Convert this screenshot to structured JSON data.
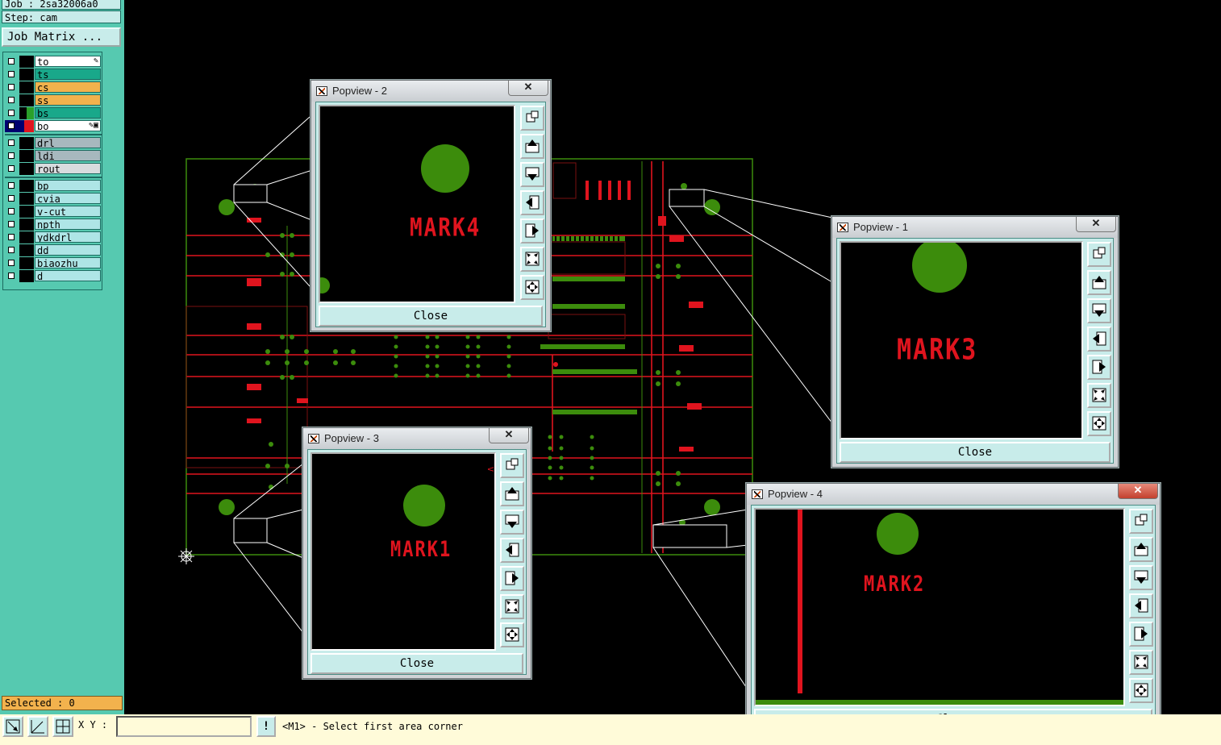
{
  "header": {
    "job": "Job : 2sa32006a0",
    "step": "Step: cam",
    "job_matrix": "Job Matrix ..."
  },
  "layers": {
    "board": [
      {
        "name": "to",
        "color": "#ffffff"
      },
      {
        "name": "ts",
        "color": "#19a88a"
      },
      {
        "name": "cs",
        "color": "#f2b24d"
      },
      {
        "name": "ss",
        "color": "#f2b24d"
      },
      {
        "name": "bs",
        "color": "#19a88a"
      },
      {
        "name": "bo",
        "color": "#ffffff"
      }
    ],
    "drill": [
      {
        "name": "drl",
        "color": "#a7b8be"
      },
      {
        "name": "ldi",
        "color": "#a7b8be"
      },
      {
        "name": "rout",
        "color": "#d8dcde"
      }
    ],
    "misc": [
      {
        "name": "bp",
        "color": "#aee5e6"
      },
      {
        "name": "cvia",
        "color": "#aee5e6"
      },
      {
        "name": "v-cut",
        "color": "#aee5e6"
      },
      {
        "name": "npth",
        "color": "#aee5e6"
      },
      {
        "name": "ydkdrl",
        "color": "#aee5e6"
      },
      {
        "name": "dd",
        "color": "#aee5e6"
      },
      {
        "name": "biaozhu",
        "color": "#aee5e6"
      },
      {
        "name": "d",
        "color": "#aee5e6"
      }
    ]
  },
  "selected": "Selected : 0",
  "bottombar": {
    "xy_label": "X Y :",
    "xy_value": "",
    "status": "<M1> - Select first area corner"
  },
  "popups": [
    {
      "title": "Popview - 2",
      "mark": "MARK4",
      "close": "Close"
    },
    {
      "title": "Popview - 1",
      "mark": "MARK3",
      "close": "Close"
    },
    {
      "title": "Popview - 3",
      "mark": "MARK1",
      "close": "Close"
    },
    {
      "title": "Popview - 4",
      "mark": "MARK2",
      "close": "Close"
    }
  ],
  "close_glyph": "✕",
  "colors": {
    "panel": "#56c9b0",
    "trace": "#e0141e",
    "pad": "#3c8c0c",
    "board_outline": "#3c8c0c",
    "selected_bg": "#f2b24d",
    "status_bg": "#fffbd9"
  }
}
